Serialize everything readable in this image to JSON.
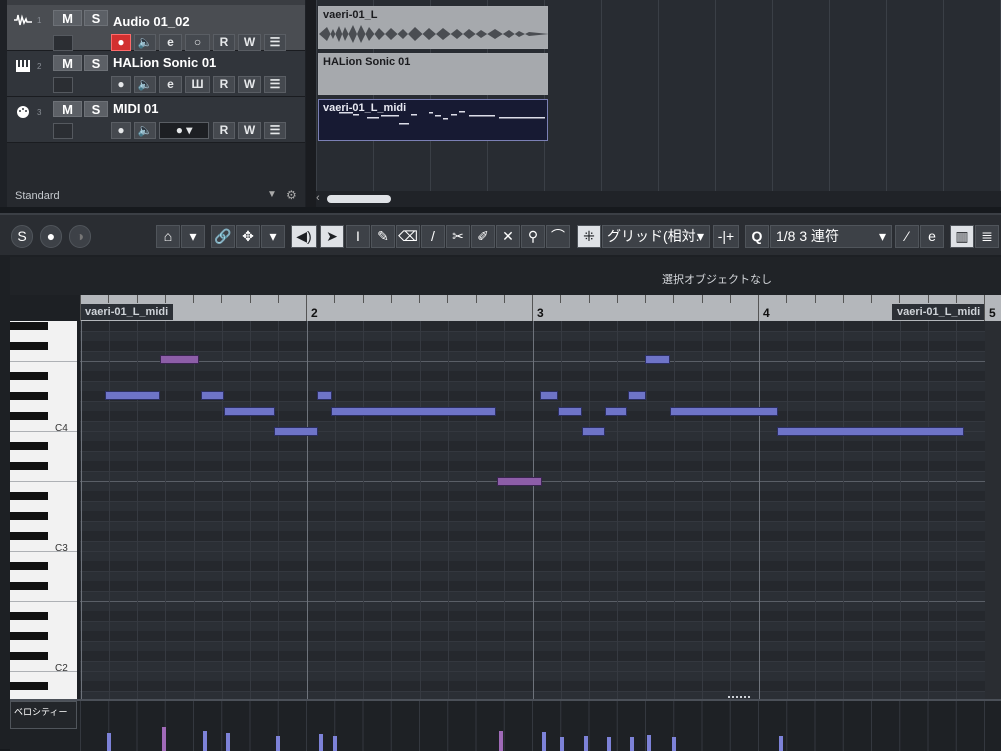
{
  "project": {
    "tracks": [
      {
        "number": "1",
        "name": "Audio 01_02",
        "mute": "M",
        "solo": "S",
        "read": "R",
        "write": "W",
        "type_icon": "waveform-icon",
        "record_armed": true
      },
      {
        "number": "2",
        "name": "HALion Sonic 01",
        "mute": "M",
        "solo": "S",
        "read": "R",
        "write": "W",
        "type_icon": "keyboard-icon",
        "record_armed": false
      },
      {
        "number": "3",
        "name": "MIDI 01",
        "mute": "M",
        "solo": "S",
        "read": "R",
        "write": "W",
        "type_icon": "midi-port-icon",
        "record_armed": false
      }
    ],
    "footer_preset": "Standard",
    "clips": [
      {
        "label": "vaeri-01_L",
        "kind": "audio"
      },
      {
        "label": "HALion Sonic 01",
        "kind": "instrument"
      },
      {
        "label": "vaeri-01_L_midi",
        "kind": "midi"
      }
    ]
  },
  "editor": {
    "toolbar": {
      "snap_type": "グリッド(相対.",
      "quantize_value": "1/8 3 連符",
      "quantize_icon": "Q"
    },
    "info_line": "選択オブジェクトなし",
    "ruler": {
      "bars": [
        "2",
        "3",
        "4",
        "5"
      ],
      "part_name_left": "vaeri-01_L_midi",
      "part_name_right": "vaeri-01_L_midi"
    },
    "keyboard_labels": [
      "C4",
      "C3",
      "C2"
    ],
    "velocity_lane_label": "ベロシティー",
    "colors": {
      "note": "#6e74c8",
      "selected_note": "#8d5ea8",
      "record": "#d23030"
    }
  }
}
